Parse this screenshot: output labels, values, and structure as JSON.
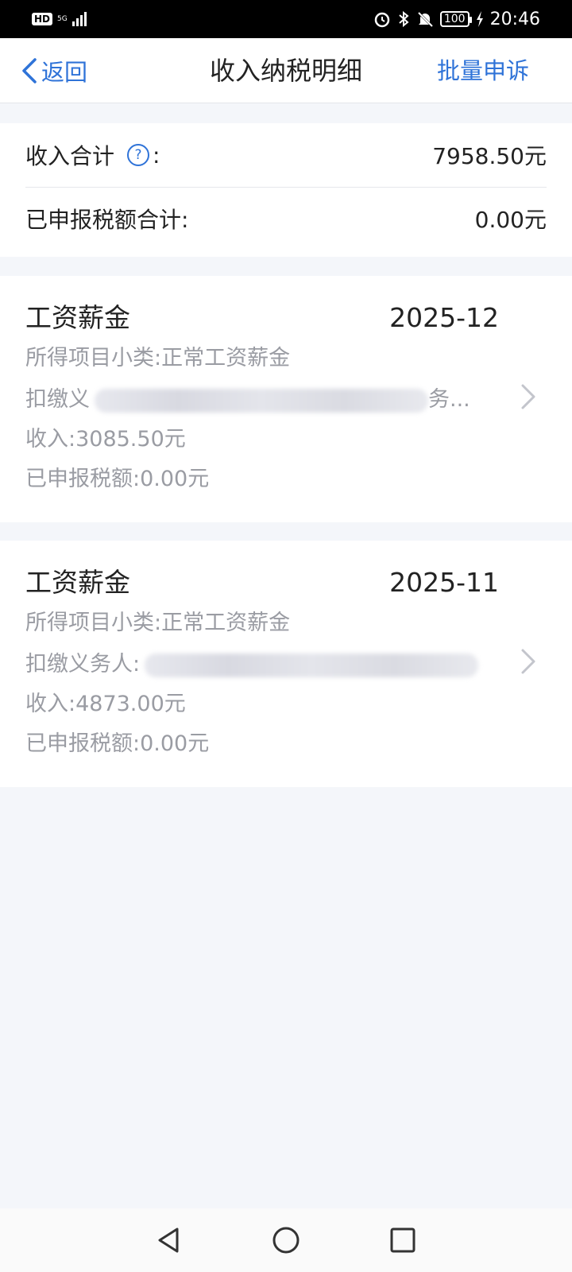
{
  "status_bar": {
    "hd": "HD",
    "network": "5G",
    "time": "20:46",
    "battery": "100",
    "icons": [
      "alarm-icon",
      "bluetooth-icon",
      "mute-icon",
      "charging-icon"
    ]
  },
  "nav": {
    "back_label": "返回",
    "title": "收入纳税明细",
    "action_label": "批量申诉"
  },
  "summary": {
    "income_label": "收入合计",
    "income_suffix": ":",
    "income_value": "7958.50元",
    "tax_label": "已申报税额合计:",
    "tax_value": "0.00元"
  },
  "records": [
    {
      "title": "工资薪金",
      "date": "2025-12",
      "subcategory": "所得项目小类:正常工资薪金",
      "withholder_prefix": "扣缴义",
      "withholder_suffix": "务...",
      "income": "收入:3085.50元",
      "tax": "已申报税额:0.00元"
    },
    {
      "title": "工资薪金",
      "date": "2025-11",
      "subcategory": "所得项目小类:正常工资薪金",
      "withholder_prefix": "扣缴义务人:",
      "withholder_suffix": "",
      "income": "收入:4873.00元",
      "tax": "已申报税额:0.00元"
    }
  ],
  "colors": {
    "accent": "#2f73d8",
    "background": "#f4f6fa",
    "secondary_text": "#9a9ca3"
  }
}
